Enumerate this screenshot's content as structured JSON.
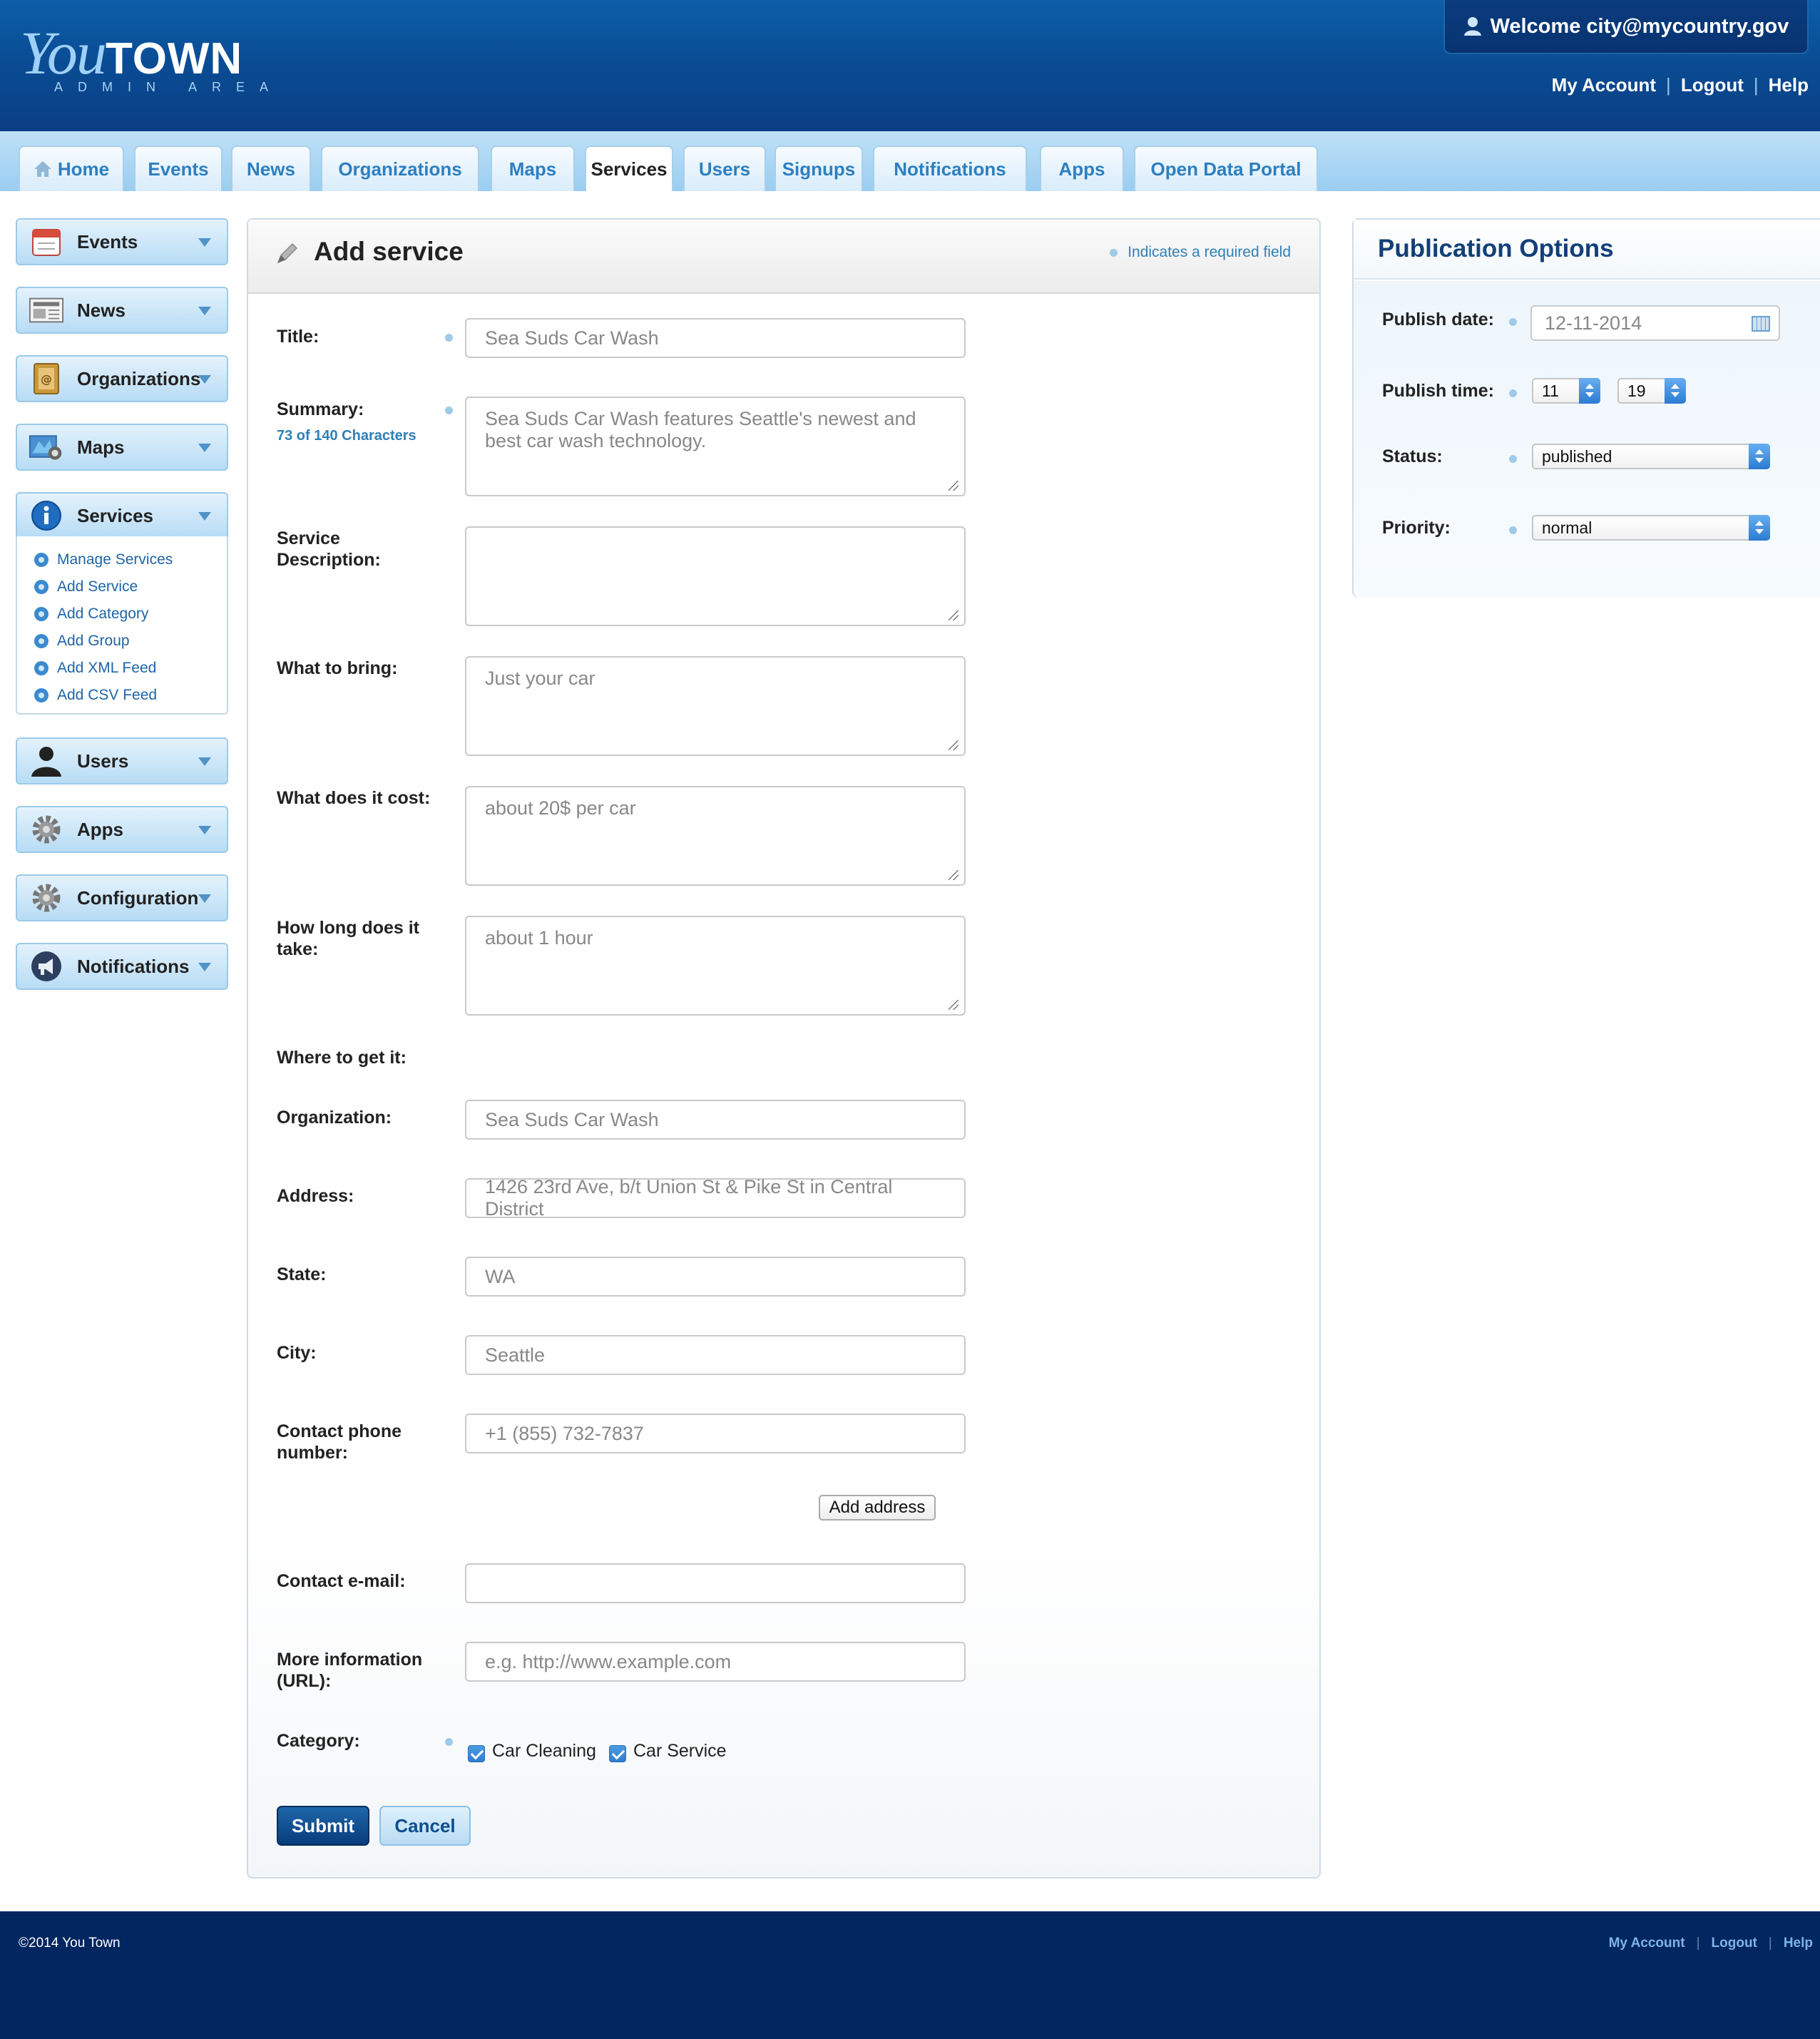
{
  "header": {
    "logo_you": "You",
    "logo_town": "TOWN",
    "logo_sub": "ADMIN AREA",
    "welcome": "Welcome city@mycountry.gov",
    "links": [
      "My Account",
      "Logout",
      "Help"
    ]
  },
  "tabs": [
    "Home",
    "Events",
    "News",
    "Organizations",
    "Maps",
    "Services",
    "Users",
    "Signups",
    "Notifications",
    "Apps",
    "Open Data Portal"
  ],
  "active_tab": "Services",
  "sidebar": {
    "events": "Events",
    "news": "News",
    "organizations": "Organizations",
    "maps": "Maps",
    "services": "Services",
    "submenu": [
      "Manage Services",
      "Add Service",
      "Add Category",
      "Add Group",
      "Add XML Feed",
      "Add CSV Feed"
    ],
    "users": "Users",
    "apps": "Apps",
    "configuration": "Configuration",
    "notifications": "Notifications"
  },
  "form": {
    "title": "Add service",
    "required_note": "Indicates a required field",
    "fields": {
      "title": {
        "label": "Title:",
        "value": "Sea Suds Car Wash"
      },
      "summary": {
        "label": "Summary:",
        "count": "73 of 140 Characters",
        "value": "Sea Suds Car Wash features Seattle's newest and best car wash technology."
      },
      "description": {
        "label_1": "Service",
        "label_2": "Description:",
        "value": ""
      },
      "bring": {
        "label": "What to bring:",
        "value": "Just your car"
      },
      "cost": {
        "label": "What does it cost:",
        "value": "about 20$ per car"
      },
      "duration": {
        "label_1": "How long does it",
        "label_2": "take:",
        "value": "about 1 hour"
      },
      "where": {
        "label": "Where to get it:"
      },
      "organization": {
        "label": "Organization:",
        "value": "Sea Suds Car Wash"
      },
      "address": {
        "label": "Address:",
        "value": "1426 23rd Ave, b/t Union St & Pike St in Central District"
      },
      "state": {
        "label": "State:",
        "value": "WA"
      },
      "city": {
        "label": "City:",
        "value": "Seattle"
      },
      "phone": {
        "label_1": "Contact phone",
        "label_2": "number:",
        "value": "+1 (855) 732-7837"
      },
      "email": {
        "label": "Contact e-mail:",
        "value": ""
      },
      "url": {
        "label_1": "More information",
        "label_2": "(URL):",
        "placeholder": "e.g. http://www.example.com"
      },
      "category": {
        "label": "Category:",
        "options": [
          "Car Cleaning",
          "Car Service"
        ]
      }
    },
    "add_address": "Add address",
    "submit": "Submit",
    "cancel": "Cancel"
  },
  "publication": {
    "title": "Publication Options",
    "date_label": "Publish date:",
    "date_value": "12-11-2014",
    "time_label": "Publish time:",
    "hour": "11",
    "minute": "19",
    "status_label": "Status:",
    "status_value": "published",
    "priority_label": "Priority:",
    "priority_value": "normal"
  },
  "footer": {
    "copyright": "©2014 You Town",
    "links": [
      "My Account",
      "Logout",
      "Help"
    ]
  },
  "colors": {
    "header_blue": "#0a4d95",
    "nav_light": "#bfe1f8",
    "link_blue": "#2d7fc0",
    "footer_navy": "#022660"
  }
}
